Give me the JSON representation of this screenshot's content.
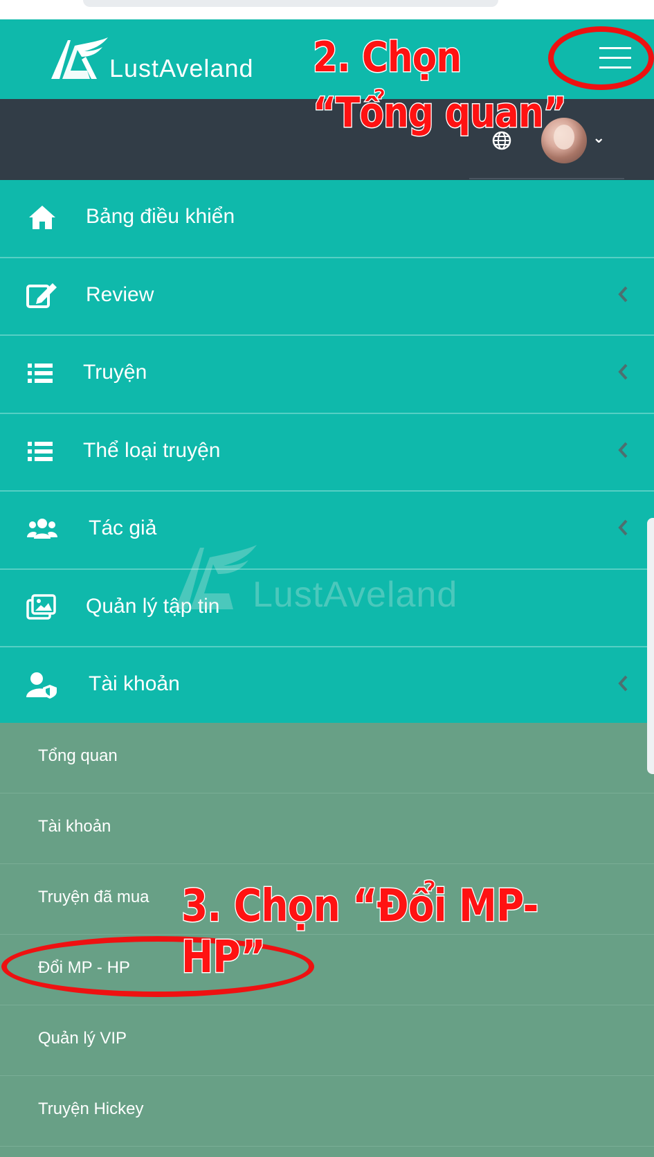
{
  "header": {
    "brand_name": "LustAveland",
    "menu_toggle_icon": "hamburger-icon",
    "language_icon": "globe-icon",
    "user_menu_icon": "chevron-down-icon",
    "brand_color": "#0fb9ab",
    "user_bar_color": "#323d47"
  },
  "sidebar": {
    "items": [
      {
        "label": "Bảng điều khiển",
        "icon": "home-icon"
      },
      {
        "label": "Review",
        "icon": "edit-icon"
      },
      {
        "label": "Truyện",
        "icon": "list-icon"
      },
      {
        "label": "Thể loại truyện",
        "icon": "list-icon"
      },
      {
        "label": "Tác giả",
        "icon": "users-icon"
      },
      {
        "label": "Quản lý tập tin",
        "icon": "images-icon"
      },
      {
        "label": "Tài khoản",
        "icon": "user-shield-icon"
      }
    ],
    "submenu": [
      {
        "label": "Tổng quan"
      },
      {
        "label": "Tài khoản"
      },
      {
        "label": "Truyện đã mua"
      },
      {
        "label": "Đổi MP - HP"
      },
      {
        "label": "Quản lý VIP"
      },
      {
        "label": "Truyện Hickey"
      }
    ],
    "submenu_color": "#68a086"
  },
  "watermark": {
    "text": "LustAveland"
  },
  "annotations": {
    "step2_line1": "2. Chọn",
    "step2_line2": "“Tổng quan”",
    "step3": "3. Chọn “Đổi MP-HP”",
    "color": "#ff1212"
  }
}
